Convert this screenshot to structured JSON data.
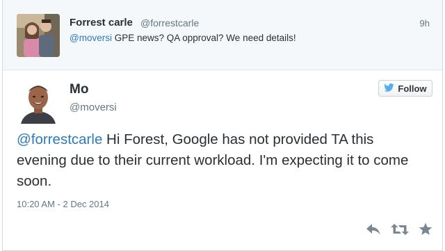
{
  "parent_tweet": {
    "name": "Forrest carle",
    "handle": "@forrestcarle",
    "time": "9h",
    "mention": "@moversi",
    "text": " GPE news? QA opproval? We need details!"
  },
  "main_tweet": {
    "name": "Mo",
    "handle": "@moversi",
    "follow_label": "Follow",
    "mention": "@forrestcarle",
    "text": " Hi Forest, Google has not provided TA this evening due to their current workload. I'm expecting it to come soon.",
    "date": "10:20 AM - 2 Dec 2014"
  },
  "icons": {
    "follow": "twitter-bird-icon",
    "reply": "reply-icon",
    "retweet": "retweet-icon",
    "favorite": "star-icon"
  },
  "colors": {
    "link": "#2b7bb9",
    "twitter_blue": "#55acee",
    "icon_gray": "#7a8690"
  }
}
